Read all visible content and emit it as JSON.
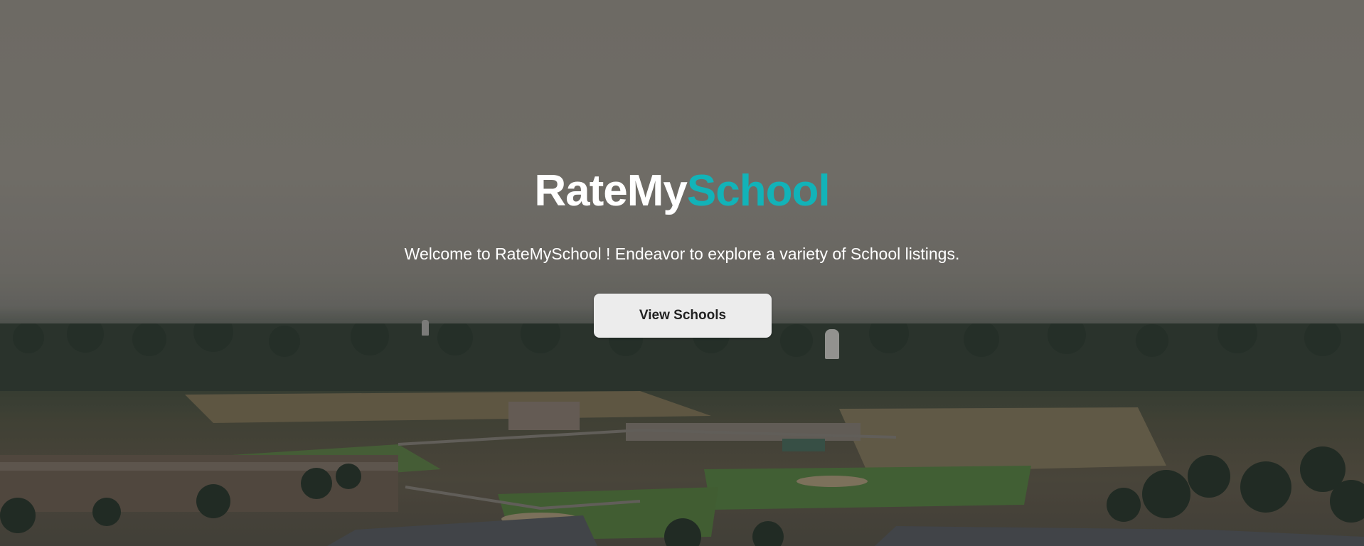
{
  "hero": {
    "logo": {
      "part_a": "RateMy",
      "part_b": "School",
      "color_a": "#ffffff",
      "color_b": "#12b3b8"
    },
    "tagline": "Welcome to RateMySchool ! Endeavor to explore a variety of School listings.",
    "cta_label": "View Schools",
    "background_image": "aerial view of town with school campus and baseball fields"
  }
}
